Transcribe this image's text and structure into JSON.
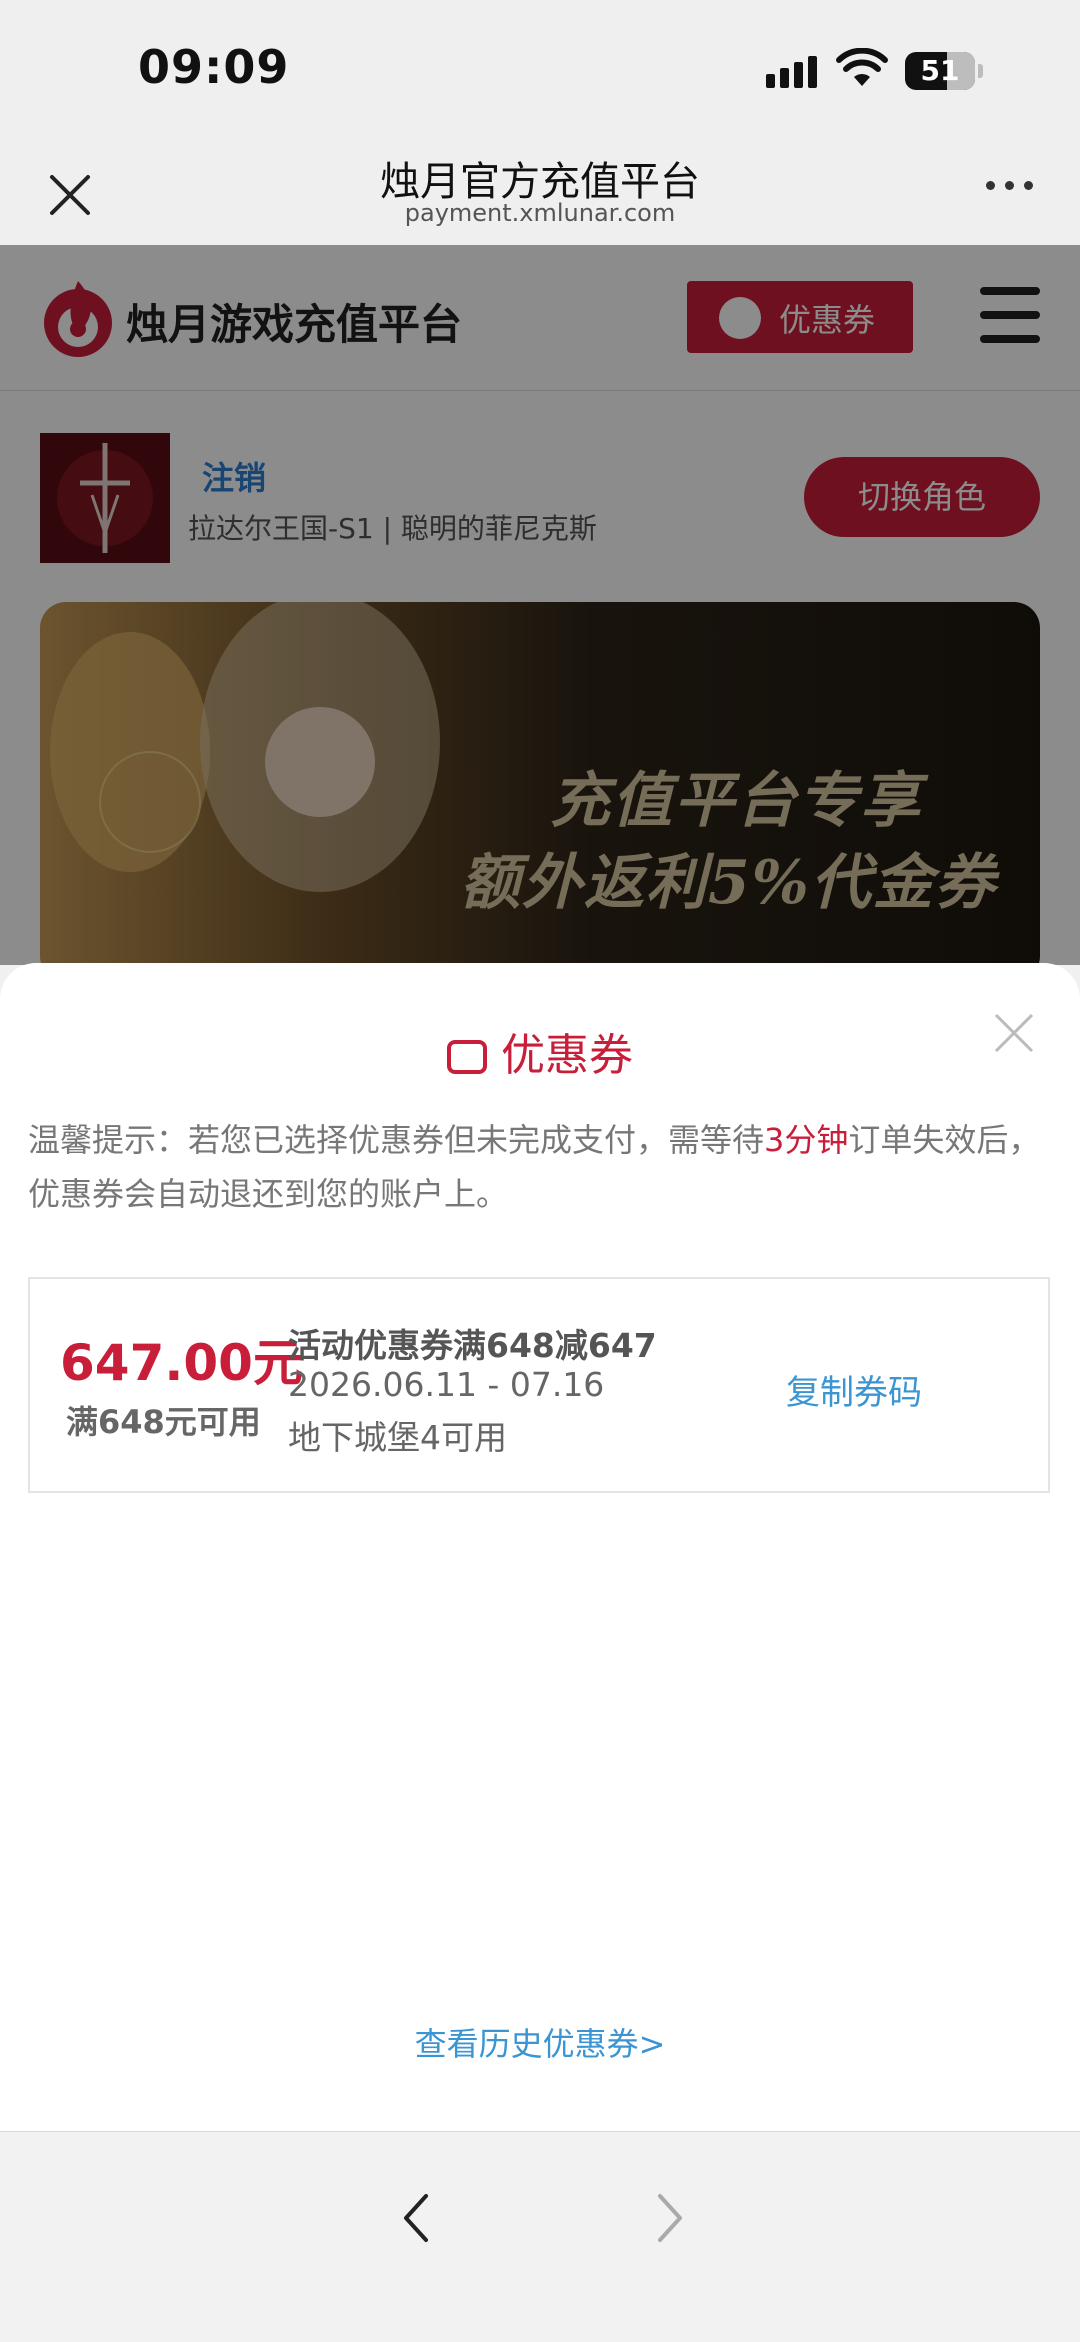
{
  "status_bar": {
    "time": "09:09",
    "battery": "51"
  },
  "nav": {
    "title": "烛月官方充值平台",
    "url": "payment.xmlunar.com"
  },
  "site": {
    "name": "烛月游戏充值平台",
    "coupon_button": "优惠券",
    "user_action": "注销",
    "role": "拉达尔王国-S1 | 聪明的菲尼克斯",
    "switch_role": "切换角色",
    "banner_line1": "充值平台专享",
    "banner_line2": "额外返利5%代金券"
  },
  "sheet": {
    "title": "优惠券",
    "tip_before": "温馨提示：若您已选择优惠券但未完成支付，需等待",
    "tip_highlight": "3分钟",
    "tip_after": "订单失效后，优惠券会自动退还到您的账户上。",
    "coupon": {
      "amount": "647.00元",
      "condition": "满648元可用",
      "title": "活动优惠券满648减647",
      "date": "2026.06.11 - 07.16",
      "scope": "地下城堡4可用",
      "copy": "复制券码"
    },
    "history_link": "查看历史优惠券>"
  },
  "colors": {
    "accent": "#c81e3a",
    "link": "#3a95d2"
  }
}
